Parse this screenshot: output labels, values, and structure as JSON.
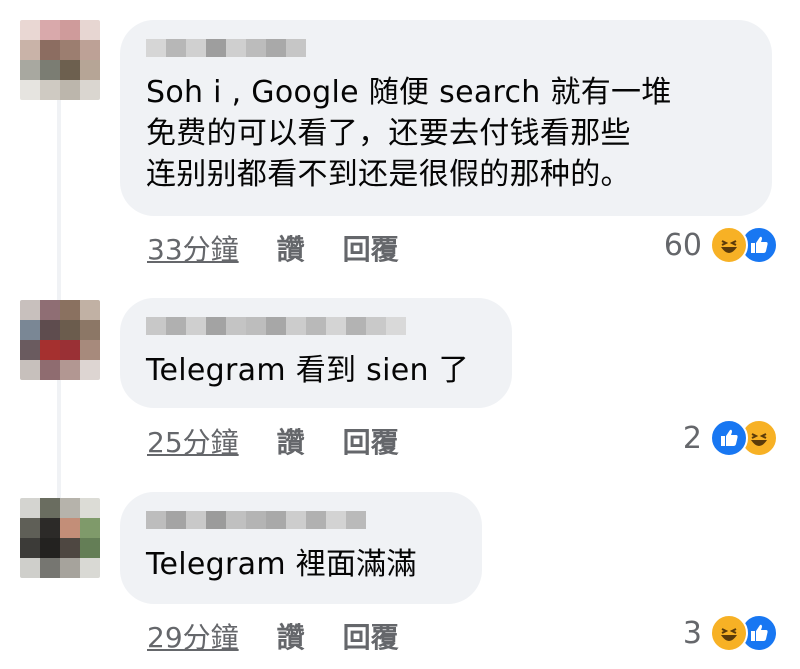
{
  "comments": [
    {
      "text": "Soh  i , Google 随便 search 就有一堆\n免费的可以看了，还要去付钱看那些\n连别别都看不到还是很假的那种的。",
      "time": "33分鐘",
      "like_label": "讚",
      "reply_label": "回覆",
      "reaction_count": "60",
      "reactions": [
        "haha-icon",
        "like-icon"
      ]
    },
    {
      "text": "Telegram 看到 sien 了",
      "time": "25分鐘",
      "like_label": "讚",
      "reply_label": "回覆",
      "reaction_count": "2",
      "reactions": [
        "like-icon",
        "haha-icon"
      ]
    },
    {
      "text": "Telegram 裡面滿滿",
      "time": "29分鐘",
      "like_label": "讚",
      "reply_label": "回覆",
      "reaction_count": "3",
      "reactions": [
        "haha-icon",
        "like-icon"
      ]
    }
  ],
  "colors": {
    "bubble": "#f0f2f5",
    "meta_text": "#65676b",
    "like_blue": "#1877f2",
    "haha_yellow": "#f7b125"
  }
}
